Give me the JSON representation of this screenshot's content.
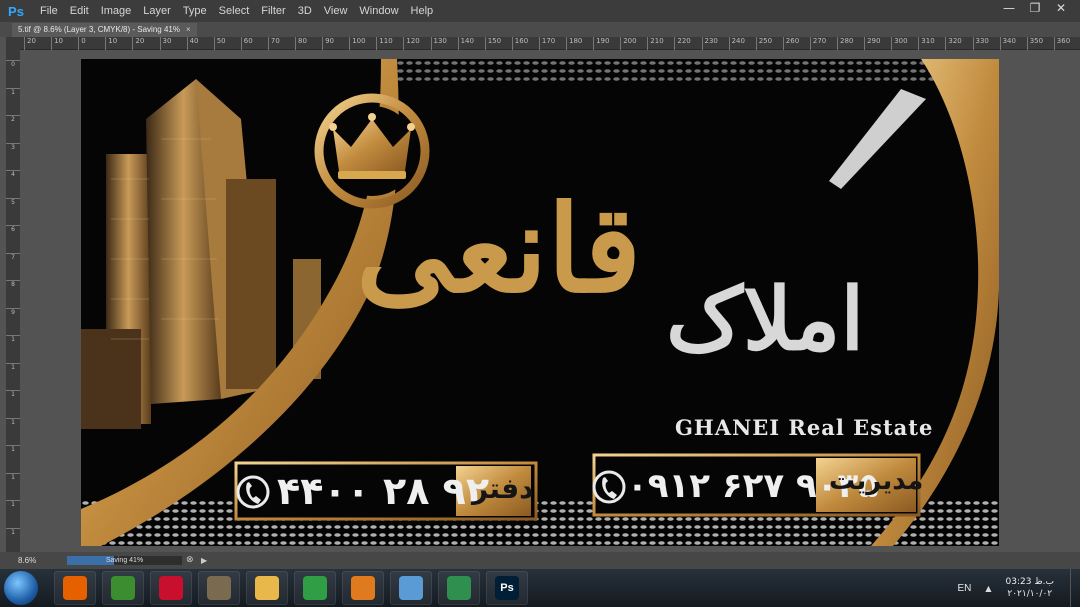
{
  "app": {
    "logo": "Ps"
  },
  "menu": [
    "File",
    "Edit",
    "Image",
    "Layer",
    "Type",
    "Select",
    "Filter",
    "3D",
    "View",
    "Window",
    "Help"
  ],
  "window_controls": {
    "minimize": "—",
    "restore": "❐",
    "close": "✕"
  },
  "tab": {
    "title": "5.tif @ 8.6% (Layer 3, CMYK/8) - Saving 41%",
    "close": "×"
  },
  "ruler": {
    "h_labels": [
      "20",
      "10",
      "0",
      "10",
      "20",
      "30",
      "40",
      "50",
      "60",
      "70",
      "80",
      "90",
      "100",
      "110",
      "120",
      "130",
      "140",
      "150",
      "160",
      "170",
      "180",
      "190",
      "200",
      "210",
      "220",
      "230",
      "240",
      "250",
      "260",
      "270",
      "280",
      "290",
      "300",
      "310",
      "320",
      "330",
      "340",
      "350",
      "360"
    ],
    "v_labels": [
      "0",
      "1",
      "2",
      "3",
      "4",
      "5",
      "6",
      "7",
      "8",
      "9",
      "1",
      "1",
      "1",
      "1",
      "1",
      "1",
      "1",
      "1"
    ]
  },
  "design": {
    "title_main": "املاک",
    "title_gold": "قانعی",
    "english_name": "GHANEI Real Estate",
    "office_label": "دفتر",
    "office_phone": "۴۴۰۰ ۲۸ ۹۲",
    "manager_label": "مدیریت",
    "manager_phone": "۰۹۱۲ ۶۲۷ ۹۰۳۵",
    "colors": {
      "gold": "#c99a4c",
      "black": "#050505",
      "silver": "#d8d8d8"
    }
  },
  "status": {
    "zoom": "8.6%",
    "progress_text": "Saving 41%",
    "progress": 0.41
  },
  "taskbar": {
    "apps": [
      {
        "name": "firefox-icon",
        "glyph": "",
        "color": "#e66000"
      },
      {
        "name": "earth-icon",
        "glyph": "",
        "color": "#3c8d2f"
      },
      {
        "name": "acrobat-icon",
        "glyph": "",
        "color": "#c8102e"
      },
      {
        "name": "archive-icon",
        "glyph": "",
        "color": "#7a6a4f"
      },
      {
        "name": "folder-icon",
        "glyph": "",
        "color": "#e8b84a"
      },
      {
        "name": "chrome-icon",
        "glyph": "",
        "color": "#2f9e44"
      },
      {
        "name": "media-player-icon",
        "glyph": "",
        "color": "#e07a1f"
      },
      {
        "name": "image-viewer-icon",
        "glyph": "",
        "color": "#5b9bd5"
      },
      {
        "name": "design-app-icon",
        "glyph": "",
        "color": "#2f8f4f"
      },
      {
        "name": "photoshop-icon",
        "glyph": "Ps",
        "color": "#001e36"
      }
    ],
    "lang": "EN",
    "tray_arrow": "▲",
    "time": "03:23 ب.ظ",
    "date": "۲۰۲۱/۱۰/۰۲"
  }
}
